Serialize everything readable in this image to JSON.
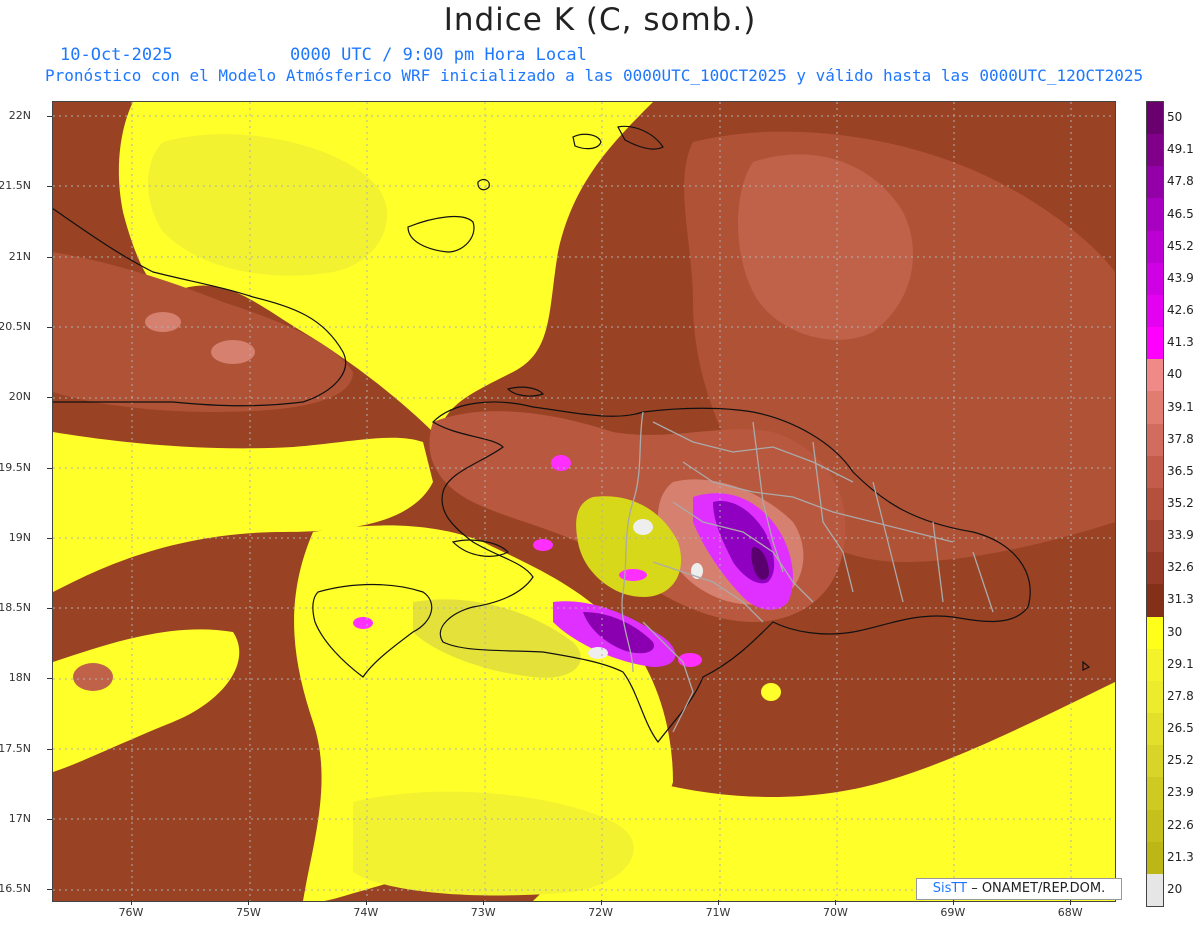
{
  "header": {
    "title": "Indice K (C, somb.)",
    "date": "10-Oct-2025",
    "time": "0000 UTC / 9:00 pm Hora Local",
    "run": "Pronóstico con el Modelo Atmósferico WRF inicializado a las 0000UTC_10OCT2025 y válido hasta las  0000UTC_12OCT2025"
  },
  "map": {
    "lat_labels": [
      "22N",
      "21.5N",
      "21N",
      "20.5N",
      "20N",
      "19.5N",
      "19N",
      "18.5N",
      "18N",
      "17.5N",
      "17N",
      "16.5N"
    ],
    "lon_labels": [
      "76W",
      "75W",
      "74W",
      "73W",
      "72W",
      "71W",
      "70W",
      "69W",
      "68W"
    ],
    "colors": {
      "yellow": "#ffff2a",
      "yellow_light": "#f2f230",
      "olive": "#d8d81a",
      "brown_dark": "#8e3a1a",
      "brown": "#a6482a",
      "brown_mid": "#b8583e",
      "brown_light": "#c8705a",
      "pink": "#e09080",
      "magenta": "#ff30ff",
      "purple": "#9000c0",
      "purple_dark": "#5a006e",
      "white_patch": "#eeeeee"
    }
  },
  "colorbar": {
    "ticks": [
      "50",
      "49.1",
      "47.8",
      "46.5",
      "45.2",
      "43.9",
      "42.6",
      "41.3",
      "40",
      "39.1",
      "37.8",
      "36.5",
      "35.2",
      "33.9",
      "32.6",
      "31.3",
      "30",
      "29.1",
      "27.8",
      "26.5",
      "25.2",
      "23.9",
      "22.6",
      "21.3",
      "20"
    ],
    "colors": [
      "#6a006e",
      "#80008a",
      "#9400a8",
      "#a800c0",
      "#bc00d4",
      "#d000e4",
      "#e400f0",
      "#ff00ff",
      "#f08a88",
      "#e07c70",
      "#d26c5e",
      "#c45c4c",
      "#b4503c",
      "#a44432",
      "#943a26",
      "#843018",
      "#ffff1a",
      "#f4f22a",
      "#eceb2e",
      "#e3e02c",
      "#d9d528",
      "#cfca22",
      "#c6c01c",
      "#bcb616",
      "#e6e6e6"
    ]
  },
  "credit": {
    "brand": "SisTT",
    "org": " – ONAMET/REP.DOM."
  }
}
